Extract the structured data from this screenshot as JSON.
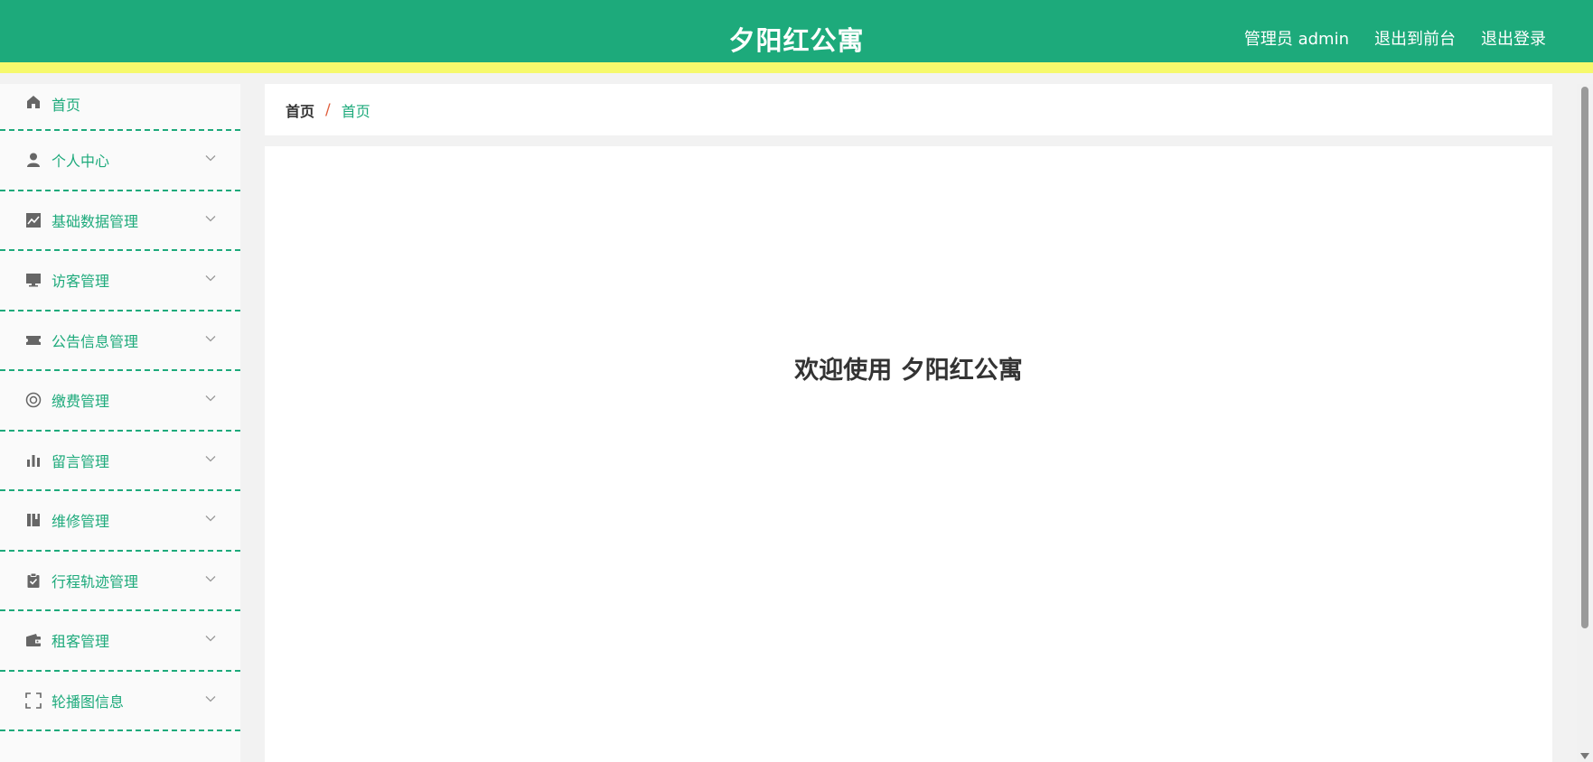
{
  "header": {
    "title": "夕阳红公寓",
    "user_label": "管理员 admin",
    "back_to_front": "退出到前台",
    "logout": "退出登录"
  },
  "sidebar": {
    "items": [
      {
        "label": "首页",
        "icon": "home-icon"
      },
      {
        "label": "个人中心",
        "icon": "user-icon"
      },
      {
        "label": "基础数据管理",
        "icon": "line-chart-icon"
      },
      {
        "label": "访客管理",
        "icon": "monitor-icon"
      },
      {
        "label": "公告信息管理",
        "icon": "ticket-icon"
      },
      {
        "label": "缴费管理",
        "icon": "lifebuoy-icon"
      },
      {
        "label": "留言管理",
        "icon": "bar-chart-icon"
      },
      {
        "label": "维修管理",
        "icon": "book-icon"
      },
      {
        "label": "行程轨迹管理",
        "icon": "clipboard-check-icon"
      },
      {
        "label": "租客管理",
        "icon": "wallet-icon"
      },
      {
        "label": "轮播图信息",
        "icon": "fullscreen-icon"
      }
    ]
  },
  "breadcrumb": {
    "home": "首页",
    "separator": "/",
    "current": "首页"
  },
  "main": {
    "welcome": "欢迎使用 夕阳红公寓"
  },
  "colors": {
    "primary": "#1daa7b",
    "header_accent": "#f6f96c",
    "separator": "#e0603f"
  }
}
